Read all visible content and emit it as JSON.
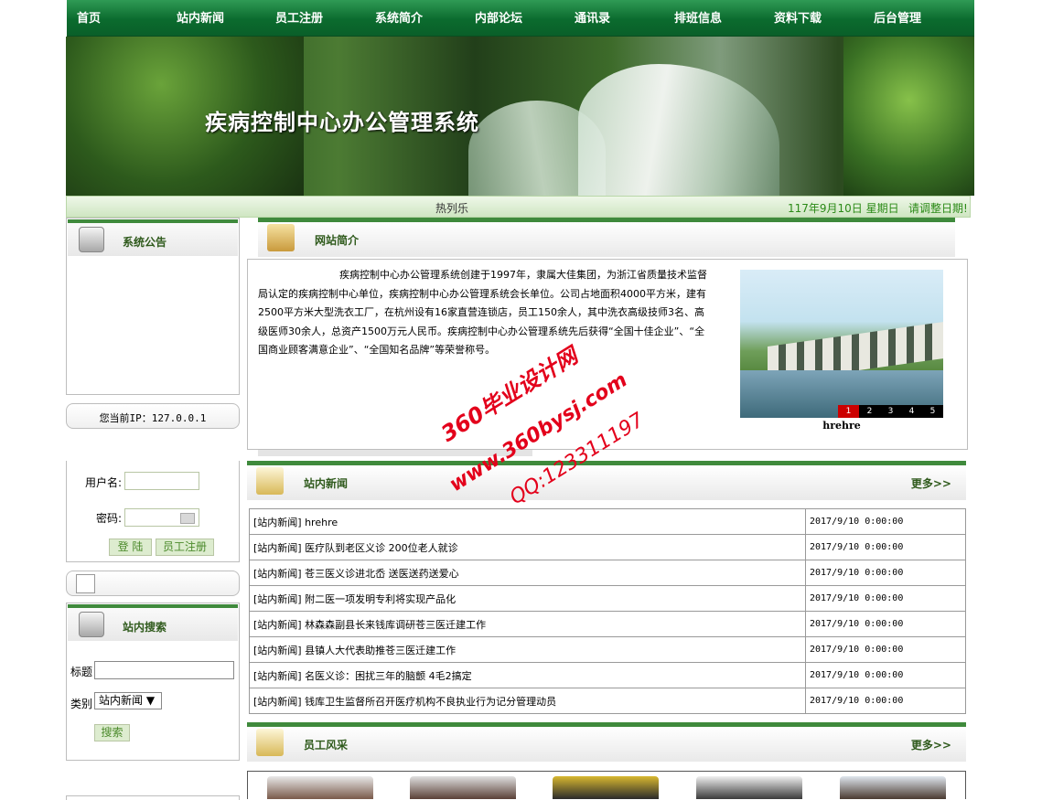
{
  "nav": [
    "首页",
    "站内新闻",
    "员工注册",
    "系统简介",
    "内部论坛",
    "通讯录",
    "排班信息",
    "资料下载",
    "后台管理"
  ],
  "banner": {
    "title": "疾病控制中心办公管理系统"
  },
  "marquee": {
    "hot": "热列乐",
    "date": "117年9月10日 星期日",
    "fix": "请调整日期!"
  },
  "sidebar": {
    "notice_title": "系统公告",
    "ip_text": "您当前IP：127.0.0.1",
    "login": {
      "username_label": "用户名:",
      "password_label": "密码:",
      "login_btn": "登 陆",
      "register_btn": "员工注册"
    },
    "search_title": "站内搜索",
    "search": {
      "title_label": "标题",
      "type_label": "类别",
      "type_value": "站内新闻 ▼",
      "search_btn": "搜索"
    }
  },
  "intro": {
    "title": "网站简介",
    "text": "疾病控制中心办公管理系统创建于1997年，隶属大佳集团，为浙江省质量技术监督局认定的疾病控制中心单位，疾病控制中心办公管理系统会长单位。公司占地面积4000平方米，建有2500平方米大型洗衣工厂，在杭州设有16家直营连锁店，员工150余人，其中洗衣高级技师3名、高级医师30余人，总资产1500万元人民币。疾病控制中心办公管理系统先后获得“全国十佳企业”、“全国商业顾客满意企业”、“全国知名品牌”等荣誉称号。",
    "slide_caption": "hrehre",
    "slide_nums": [
      "1",
      "2",
      "3",
      "4",
      "5"
    ]
  },
  "news": {
    "title": "站内新闻",
    "more": "更多>>",
    "rows": [
      {
        "title": "[站内新闻] hrehre",
        "date": "2017/9/10 0:00:00"
      },
      {
        "title": "[站内新闻] 医疗队到老区义诊 200位老人就诊",
        "date": "2017/9/10 0:00:00"
      },
      {
        "title": "[站内新闻] 苍三医义诊进北岙 送医送药送爱心",
        "date": "2017/9/10 0:00:00"
      },
      {
        "title": "[站内新闻] 附二医一项发明专利将实现产品化",
        "date": "2017/9/10 0:00:00"
      },
      {
        "title": "[站内新闻] 林森森副县长来钱库调研苍三医迁建工作",
        "date": "2017/9/10 0:00:00"
      },
      {
        "title": "[站内新闻] 县镇人大代表助推苍三医迁建工作",
        "date": "2017/9/10 0:00:00"
      },
      {
        "title": "[站内新闻] 名医义诊：困扰三年的脑颤 4毛2搞定",
        "date": "2017/9/10 0:00:00"
      },
      {
        "title": "[站内新闻] 钱库卫生监督所召开医疗机构不良执业行为记分管理动员",
        "date": "2017/9/10 0:00:00"
      }
    ]
  },
  "staff": {
    "title": "员工风采",
    "more": "更多>>"
  },
  "watermark": {
    "line1": "360毕业设计网",
    "line2": "www.360bysj.com",
    "line3": "QQ:123311197"
  },
  "colors": {
    "nav_green": "#0b6b2e",
    "accent_green": "#3f8a3c",
    "watermark_red": "#e3001b"
  }
}
